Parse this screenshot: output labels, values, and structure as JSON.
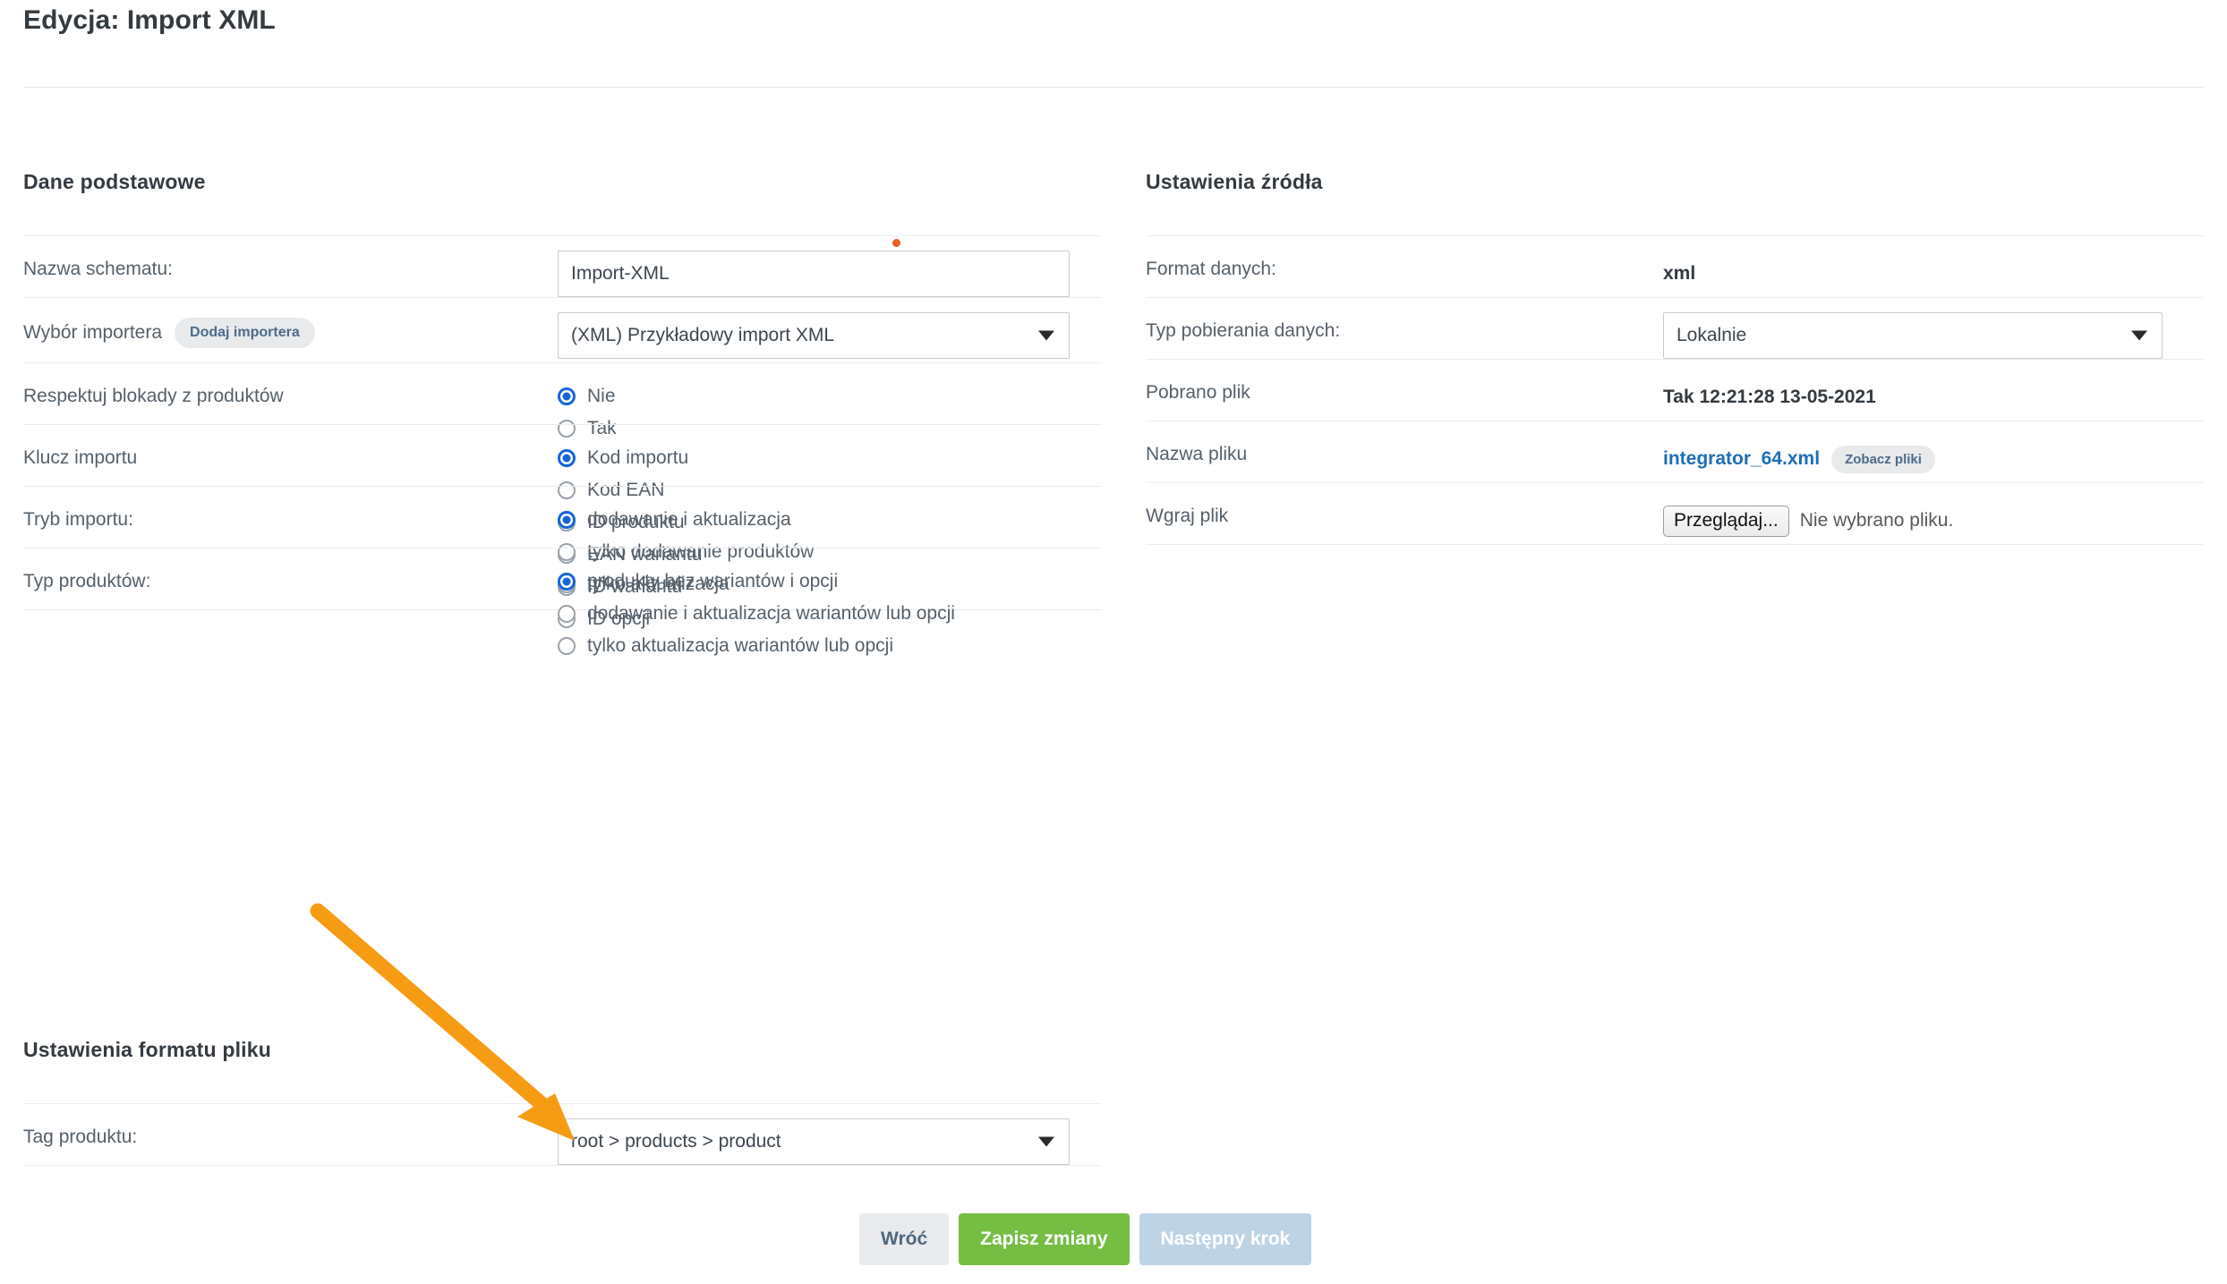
{
  "header": {
    "title": "Edycja: Import XML"
  },
  "basic": {
    "section_title": "Dane podstawowe",
    "schema_name_label": "Nazwa schematu:",
    "schema_name_value": "Import-XML",
    "importer_label": "Wybór importera",
    "importer_add_badge": "Dodaj importera",
    "importer_value": "(XML) Przykładowy import XML",
    "respect_locks_label": "Respektuj blokady z produktów",
    "respect_locks_options": [
      "Nie",
      "Tak"
    ],
    "respect_locks_selected": "Nie",
    "import_key_label": "Klucz importu",
    "import_key_options": [
      "Kod importu",
      "Kod EAN",
      "ID produktu",
      "EAN wariantu",
      "ID wariantu",
      "ID opcji"
    ],
    "import_key_selected": "Kod importu",
    "import_mode_label": "Tryb importu:",
    "import_mode_options": [
      "dodawanie i aktualizacja",
      "tylko dodawanie produktów",
      "tylko aktualizacja"
    ],
    "import_mode_selected": "dodawanie i aktualizacja",
    "product_type_label": "Typ produktów:",
    "product_type_options": [
      "produkty bez wariantów i opcji",
      "dodawanie i aktualizacja wariantów lub opcji",
      "tylko aktualizacja wariantów lub opcji"
    ],
    "product_type_selected": "produkty bez wariantów i opcji"
  },
  "source": {
    "section_title": "Ustawienia źródła",
    "data_format_label": "Format danych:",
    "data_format_value": "xml",
    "download_type_label": "Typ pobierania danych:",
    "download_type_value": "Lokalnie",
    "file_downloaded_label": "Pobrano plik",
    "file_downloaded_value": "Tak 12:21:28 13-05-2021",
    "file_name_label": "Nazwa pliku",
    "file_name_value": "integrator_64.xml",
    "file_name_badge": "Zobacz pliki",
    "upload_label": "Wgraj plik",
    "upload_button": "Przeglądaj...",
    "upload_status": "Nie wybrano pliku."
  },
  "file_format": {
    "section_title": "Ustawienia formatu pliku",
    "product_tag_label": "Tag produktu:",
    "product_tag_value": "root > products > product"
  },
  "actions": {
    "back": "Wróć",
    "save": "Zapisz zmiany",
    "next": "Następny krok"
  },
  "annotations": {
    "arrow_color": "#f59c14",
    "dot_color": "#ef5d22"
  }
}
